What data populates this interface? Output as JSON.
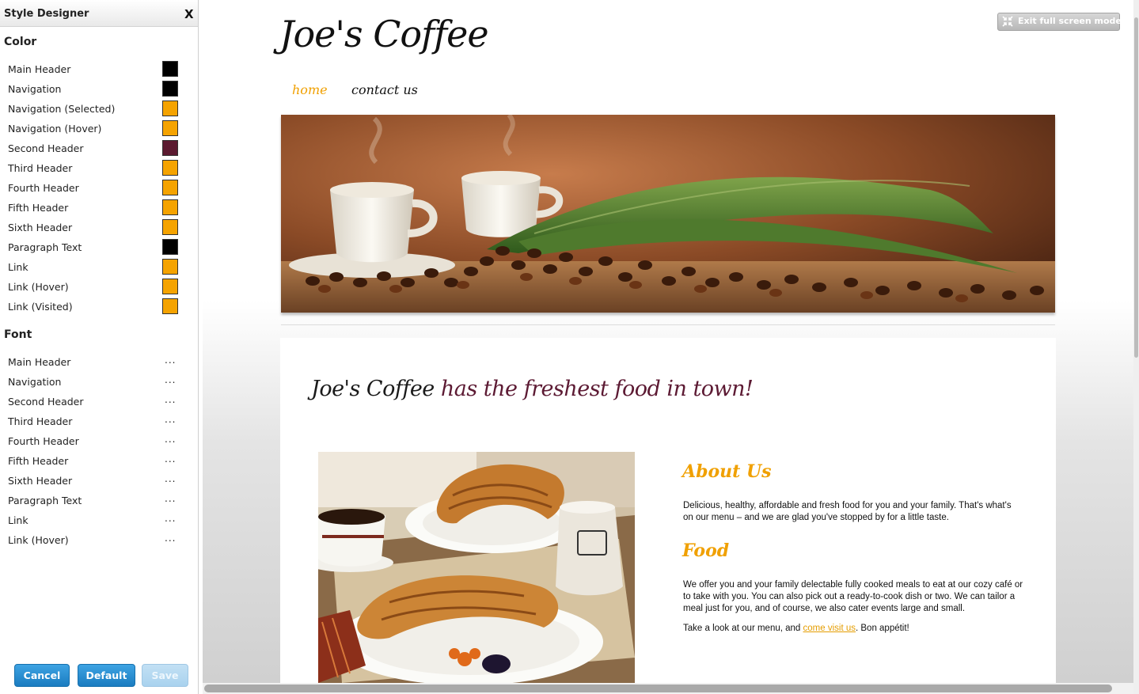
{
  "panel": {
    "title": "Style Designer",
    "close": "X",
    "color_section": "Color",
    "font_section": "Font",
    "color_items": [
      {
        "label": "Main Header",
        "color": "#000000"
      },
      {
        "label": "Navigation",
        "color": "#000000"
      },
      {
        "label": "Navigation (Selected)",
        "color": "#f5a300"
      },
      {
        "label": "Navigation (Hover)",
        "color": "#f5a300"
      },
      {
        "label": "Second Header",
        "color": "#5b1a30"
      },
      {
        "label": "Third Header",
        "color": "#f5a300"
      },
      {
        "label": "Fourth Header",
        "color": "#f5a300"
      },
      {
        "label": "Fifth Header",
        "color": "#f5a300"
      },
      {
        "label": "Sixth Header",
        "color": "#f5a300"
      },
      {
        "label": "Paragraph Text",
        "color": "#000000"
      },
      {
        "label": "Link",
        "color": "#f5a300"
      },
      {
        "label": "Link (Hover)",
        "color": "#f5a300"
      },
      {
        "label": "Link (Visited)",
        "color": "#f5a300"
      }
    ],
    "font_items": [
      {
        "label": "Main Header",
        "value": "..."
      },
      {
        "label": "Navigation",
        "value": "..."
      },
      {
        "label": "Second Header",
        "value": "..."
      },
      {
        "label": "Third Header",
        "value": "..."
      },
      {
        "label": "Fourth Header",
        "value": "..."
      },
      {
        "label": "Fifth Header",
        "value": "..."
      },
      {
        "label": "Sixth Header",
        "value": "..."
      },
      {
        "label": "Paragraph Text",
        "value": "..."
      },
      {
        "label": "Link",
        "value": "..."
      },
      {
        "label": "Link (Hover)",
        "value": "..."
      }
    ],
    "buttons": {
      "cancel": "Cancel",
      "default": "Default",
      "save": "Save"
    }
  },
  "preview": {
    "exit_fullscreen": "Exit full screen mode",
    "site_title": "Joe's Coffee",
    "nav": [
      {
        "label": "home",
        "selected": true
      },
      {
        "label": "contact us",
        "selected": false
      }
    ],
    "tagline_brand": "Joe's Coffee",
    "tagline_rest": " has the freshest food in town!",
    "about_heading": "About Us",
    "about_text": "Delicious, healthy, affordable and fresh food for you and your family. That's what's on our menu – and we are glad you've stopped by for a little taste.",
    "food_heading": "Food",
    "food_text": "We offer you and your family delectable fully cooked meals to eat at our cozy café or to take with you. You can also pick out a ready-to-cook dish or two. We can tailor a meal just for you, and of course, we also cater events large and small.",
    "visit_prefix": "Take a look at our menu, and ",
    "visit_link": "come visit us",
    "visit_suffix": ". Bon appétit!"
  },
  "colors": {
    "accent_orange": "#f0a000",
    "second_header": "#5c1a33",
    "button_blue": "#1a7cc0"
  }
}
